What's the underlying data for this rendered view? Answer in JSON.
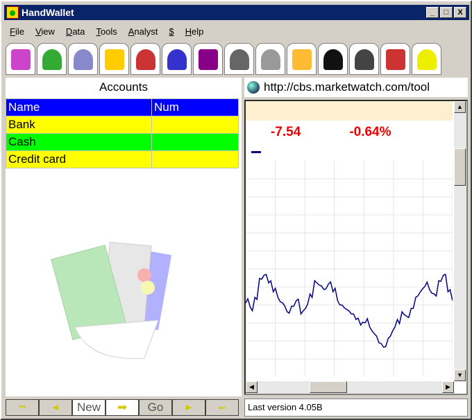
{
  "window": {
    "title": "HandWallet",
    "min": "_",
    "max": "□",
    "close": "X"
  },
  "menu": [
    "File",
    "View",
    "Data",
    "Tools",
    "Analyst",
    "$",
    "Help"
  ],
  "toolbar": [
    "shopping-bag-icon",
    "money-bag-icon",
    "documents-icon",
    "pie-chart-icon",
    "bar-chart-icon",
    "line-chart-icon",
    "help-book-icon",
    "computer-icon",
    "printer-icon",
    "folder-icon",
    "binoculars-icon",
    "camera-icon",
    "notebook-icon",
    "question-icon"
  ],
  "accounts": {
    "title": "Accounts",
    "headers": [
      "Name",
      "Num"
    ],
    "rows": [
      {
        "name": "Bank",
        "num": "",
        "color": "#ffff00"
      },
      {
        "name": "Cash",
        "num": "",
        "color": "#00ff00"
      },
      {
        "name": "Credit card",
        "num": "",
        "color": "#ffff00"
      }
    ]
  },
  "browser": {
    "url": "http://cbs.marketwatch.com/tool",
    "change": "-7.54",
    "change_pct": "-0.64%"
  },
  "chart_data": {
    "type": "line",
    "title": "",
    "xlabel": "",
    "ylabel": "",
    "series": [
      {
        "name": "index",
        "values": [
          50,
          46,
          55,
          72,
          75,
          68,
          60,
          55,
          50,
          42,
          47,
          52,
          40,
          45,
          58,
          70,
          66,
          62,
          67,
          60,
          52,
          48,
          44,
          40,
          35,
          30,
          32,
          28,
          22,
          14,
          10,
          18,
          25,
          35,
          42,
          38,
          45,
          55,
          60,
          65,
          62,
          58,
          70,
          75,
          60,
          52
        ]
      }
    ],
    "ylim": [
      0,
      100
    ],
    "color": "#000080"
  },
  "nav": {
    "first": "⏮",
    "prev": "◀",
    "new": "New",
    "arrow": "➡",
    "go": "Go",
    "next": "▶",
    "last": "⏭"
  },
  "status": "Last version 4.05B"
}
